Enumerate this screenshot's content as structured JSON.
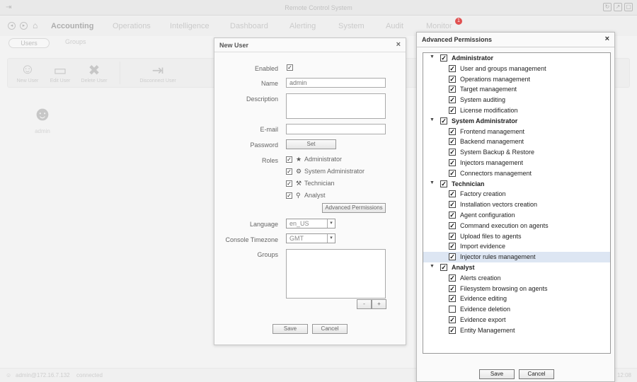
{
  "window": {
    "title": "Remote Control System"
  },
  "nav": {
    "menu": [
      "Accounting",
      "Operations",
      "Intelligence",
      "Dashboard",
      "Alerting",
      "System",
      "Audit",
      "Monitor"
    ],
    "active": "Accounting",
    "monitor_badge": "1"
  },
  "subtabs": [
    "Users",
    "Groups"
  ],
  "toolbar": {
    "tools": [
      "New User",
      "Edit User",
      "Delete User",
      "Disconnect User"
    ]
  },
  "users": [
    {
      "name": "admin"
    }
  ],
  "statusbar": {
    "user": "admin@172.16.7.132",
    "status": "connected",
    "right": "12:08"
  },
  "new_user": {
    "title": "New User",
    "labels": {
      "enabled": "Enabled",
      "name": "Name",
      "description": "Description",
      "email": "E-mail",
      "password": "Password",
      "roles": "Roles",
      "language": "Language",
      "timezone": "Console Timezone",
      "groups": "Groups"
    },
    "name_value": "admin",
    "password_button": "Set",
    "roles": [
      "Administrator",
      "System Administrator",
      "Technician",
      "Analyst"
    ],
    "advanced_button": "Advanced Permissions",
    "language_value": "en_US",
    "timezone_value": "GMT",
    "groups_minus": "-",
    "groups_plus": "+",
    "save_label": "Save",
    "cancel_label": "Cancel"
  },
  "advanced_permissions": {
    "title": "Advanced Permissions",
    "groups": [
      {
        "name": "Administrator",
        "checked": true,
        "items": [
          {
            "label": "User and groups management",
            "checked": true
          },
          {
            "label": "Operations management",
            "checked": true
          },
          {
            "label": "Target management",
            "checked": true
          },
          {
            "label": "System auditing",
            "checked": true
          },
          {
            "label": "License modification",
            "checked": true
          }
        ]
      },
      {
        "name": "System Administrator",
        "checked": true,
        "items": [
          {
            "label": "Frontend management",
            "checked": true
          },
          {
            "label": "Backend management",
            "checked": true
          },
          {
            "label": "System Backup & Restore",
            "checked": true
          },
          {
            "label": "Injectors management",
            "checked": true
          },
          {
            "label": "Connectors management",
            "checked": true
          }
        ]
      },
      {
        "name": "Technician",
        "checked": true,
        "items": [
          {
            "label": "Factory creation",
            "checked": true
          },
          {
            "label": "Installation vectors creation",
            "checked": true
          },
          {
            "label": "Agent configuration",
            "checked": true
          },
          {
            "label": "Command execution on agents",
            "checked": true
          },
          {
            "label": "Upload files to agents",
            "checked": true
          },
          {
            "label": "Import evidence",
            "checked": true
          },
          {
            "label": "Injector rules management",
            "checked": true,
            "selected": true
          }
        ]
      },
      {
        "name": "Analyst",
        "checked": true,
        "items": [
          {
            "label": "Alerts creation",
            "checked": true
          },
          {
            "label": "Filesystem browsing on agents",
            "checked": true
          },
          {
            "label": "Evidence editing",
            "checked": true
          },
          {
            "label": "Evidence deletion",
            "checked": false
          },
          {
            "label": "Evidence export",
            "checked": true
          },
          {
            "label": "Entity Management",
            "checked": true
          }
        ]
      }
    ],
    "save_label": "Save",
    "cancel_label": "Cancel"
  }
}
